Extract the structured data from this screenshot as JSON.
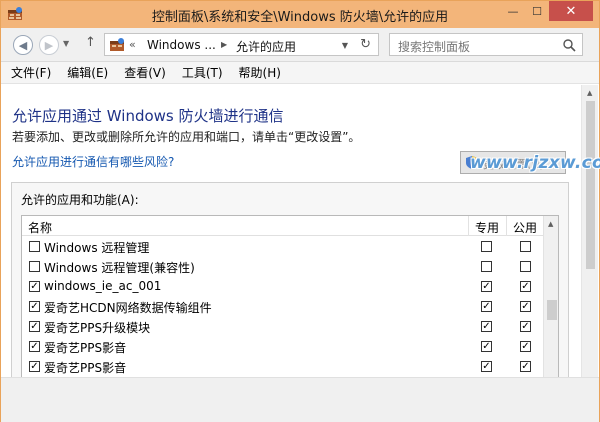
{
  "window": {
    "title": "控制面板\\系统和安全\\Windows 防火墙\\允许的应用",
    "buttons": {
      "minimize": "—",
      "maximize": "☐",
      "close": "✕"
    }
  },
  "address_bar": {
    "back_icon": "arrow-left-icon",
    "forward_icon": "arrow-right-icon",
    "overflow": "«",
    "crumbs": [
      "Windows ...",
      "允许的应用"
    ],
    "crumb_separator": "▶",
    "refresh_icon": "refresh-icon"
  },
  "search": {
    "placeholder": "搜索控制面板"
  },
  "menu": [
    "文件(F)",
    "编辑(E)",
    "查看(V)",
    "工具(T)",
    "帮助(H)"
  ],
  "main": {
    "heading": "允许应用通过 Windows 防火墙进行通信",
    "description": "若要添加、更改或删除所允许的应用和端口，请单击“更改设置”。",
    "risk_link": "允许应用进行通信有哪些风险?",
    "change_settings_button": "更改设置(N)"
  },
  "apps_group": {
    "label": "允许的应用和功能(A):",
    "columns": {
      "name": "名称",
      "private": "专用",
      "public": "公用"
    },
    "rows": [
      {
        "name": "Windows 远程管理",
        "enabled": false,
        "private": false,
        "public": false
      },
      {
        "name": "Windows 远程管理(兼容性)",
        "enabled": false,
        "private": false,
        "public": false
      },
      {
        "name": "windows_ie_ac_001",
        "enabled": true,
        "private": true,
        "public": true
      },
      {
        "name": "爱奇艺HCDN网络数据传输组件",
        "enabled": true,
        "private": true,
        "public": true
      },
      {
        "name": "爱奇艺PPS升级模块",
        "enabled": true,
        "private": true,
        "public": true
      },
      {
        "name": "爱奇艺PPS影音",
        "enabled": true,
        "private": true,
        "public": true
      },
      {
        "name": "爱奇艺PPS影音",
        "enabled": true,
        "private": true,
        "public": true
      }
    ]
  },
  "watermark": "www.rjzxw.com",
  "colors": {
    "title_bar": "#f3b57a",
    "heading": "#1e3287",
    "link": "#1558b0"
  }
}
